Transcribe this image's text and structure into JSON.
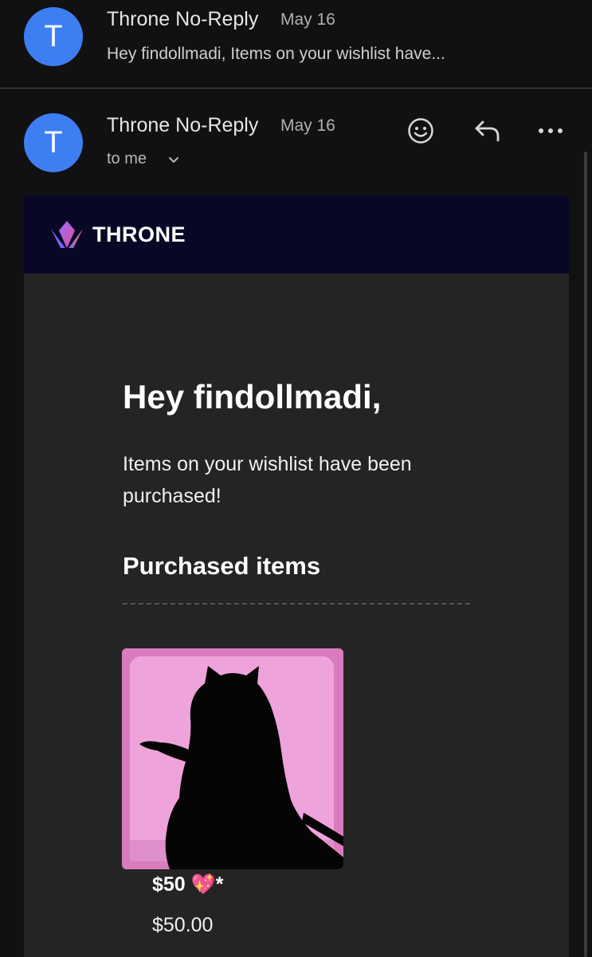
{
  "thread_preview": {
    "avatar_letter": "T",
    "sender": "Throne No-Reply",
    "date": "May 16",
    "snippet": "Hey findollmadi, Items on your wishlist have..."
  },
  "message_header": {
    "avatar_letter": "T",
    "sender": "Throne No-Reply",
    "date": "May 16",
    "recipient": "to me",
    "icons": [
      "emoji-icon",
      "reply-icon",
      "more-icon"
    ]
  },
  "email": {
    "brand": "THRONE",
    "greeting": "Hey findollmadi,",
    "message": "Items on your wishlist have been purchased!",
    "section_title": "Purchased items",
    "item": {
      "name": "$50 💖*",
      "price": "$50.00"
    }
  },
  "colors": {
    "background": "#111111",
    "avatar": "#3d7ff3",
    "brand_bar": "#080826",
    "card": "#242424",
    "item_image": "#d97cbf"
  }
}
